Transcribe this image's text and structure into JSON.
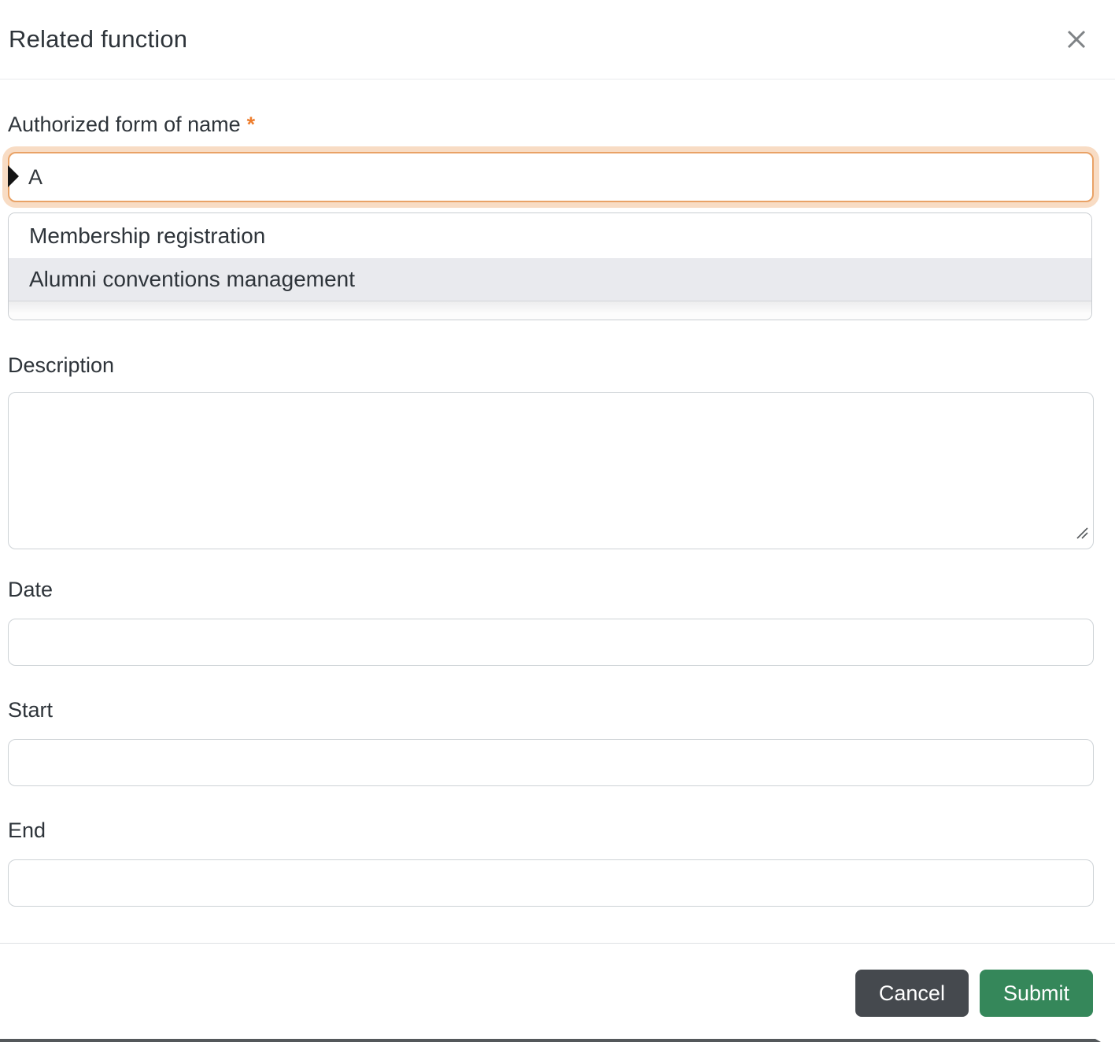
{
  "modal": {
    "title": "Related function"
  },
  "form": {
    "authorized_name": {
      "label": "Authorized form of name",
      "required_marker": "*",
      "value": "A",
      "dropdown_options": [
        {
          "label": "Membership registration",
          "highlighted": false
        },
        {
          "label": "Alumni conventions management",
          "highlighted": true
        }
      ]
    },
    "description": {
      "label": "Description",
      "value": ""
    },
    "date": {
      "label": "Date",
      "value": ""
    },
    "start": {
      "label": "Start",
      "value": ""
    },
    "end": {
      "label": "End",
      "value": ""
    }
  },
  "footer": {
    "cancel_label": "Cancel",
    "submit_label": "Submit"
  },
  "icons": {
    "close": "close-icon",
    "resize": "resize-handle-icon",
    "cursor": "mouse-pointer"
  },
  "colors": {
    "accent_orange": "#ed7d2d",
    "focus_border": "#e9a266",
    "focus_glow": "#f8dcc4",
    "highlighted_row": "#e9eaee",
    "cancel_button": "#45494e",
    "submit_button": "#35875a",
    "window_edge": "#54585b"
  }
}
